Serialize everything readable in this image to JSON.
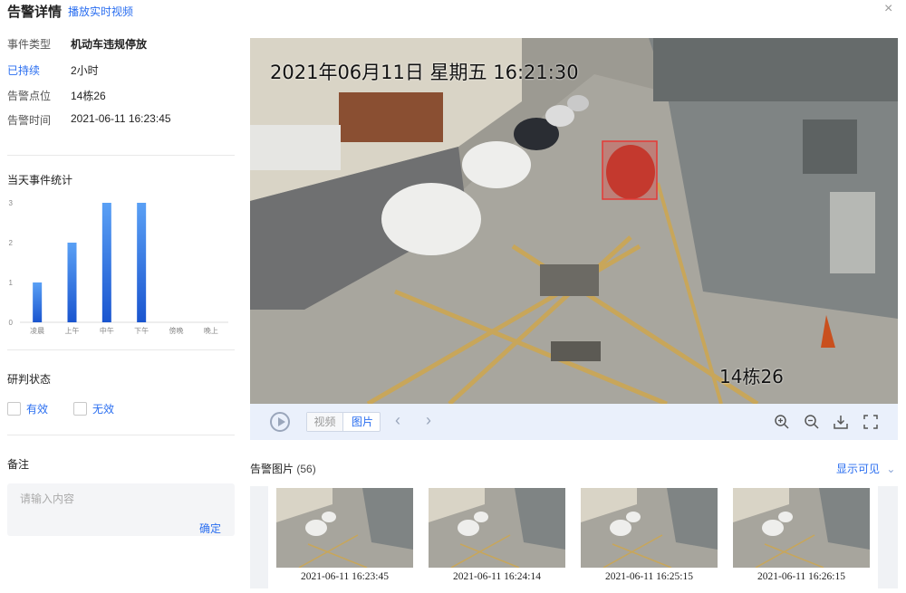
{
  "header": {
    "title": "告警详情",
    "play_live": "播放实时视频",
    "close": "×"
  },
  "info": {
    "event_type_label": "事件类型",
    "event_type_value": "机动车违规停放",
    "duration_label": "已持续",
    "duration_value": "2小时",
    "location_label": "告警点位",
    "location_value": "14栋26",
    "time_label": "告警时间",
    "time_value": "2021-06-11 16:23:45"
  },
  "stats": {
    "title": "当天事件统计"
  },
  "chart_data": {
    "type": "bar",
    "categories": [
      "凌晨",
      "上午",
      "中午",
      "下午",
      "傍晚",
      "晚上"
    ],
    "values": [
      1,
      2,
      3,
      3,
      0,
      0
    ],
    "ylim": [
      0,
      3
    ],
    "yticks": [
      0,
      1,
      2,
      3
    ],
    "grid": false,
    "bar_color": "#1e5fd6"
  },
  "judge": {
    "title": "研判状态",
    "valid_label": "有效",
    "invalid_label": "无效"
  },
  "remark": {
    "title": "备注",
    "placeholder": "请输入内容",
    "confirm": "确定"
  },
  "video": {
    "osd_time": "2021年06月11日 星期五 16:21:30",
    "osd_location": "14栋26",
    "tab_video": "视频",
    "tab_image": "图片",
    "prev": "‹",
    "next": "›"
  },
  "gallery": {
    "title": "告警图片",
    "count": "(56)",
    "show_visible": "显示可见",
    "chevron": "⌄",
    "items": [
      {
        "time": "2021-06-11 16:23:45"
      },
      {
        "time": "2021-06-11 16:24:14"
      },
      {
        "time": "2021-06-11 16:25:15"
      },
      {
        "time": "2021-06-11 16:26:15"
      }
    ]
  },
  "colors": {
    "accent": "#2a6ef0",
    "alert_box": "#e53935"
  }
}
